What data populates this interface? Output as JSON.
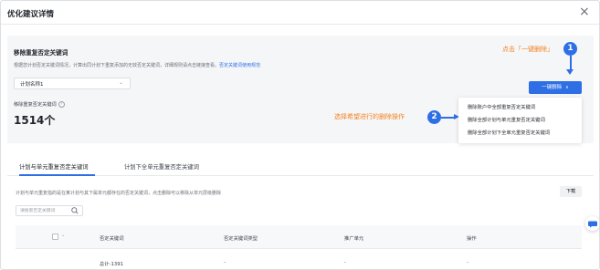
{
  "dialog": {
    "title": "优化建议详情",
    "close_symbol": "×"
  },
  "section": {
    "title": "移除重复否定关键词",
    "desc_text": "根据您计划否定关键词情况，计算出同计划下重复添加的无效否定关键词，详细规则请点击链接查看。",
    "desc_link": "否定关键词使用规范",
    "plan_select_value": "计划名称1",
    "repeat_label": "移除重复否定关键词",
    "repeat_help": "?",
    "repeat_count": "1514个"
  },
  "annotations": {
    "step1_text": "点击「一键删除」",
    "step1_num": "1",
    "step2_text": "选择希望进行的删除操作",
    "step2_num": "2"
  },
  "actions": {
    "delete_button": "一键删除",
    "dropdown_items": [
      "删除账户中全部重复否定关键词",
      "删除全部计划与单元重复否定关键词",
      "删除全部计划下全单元重复否定关键词"
    ]
  },
  "tabs": [
    {
      "label": "计划与单元重复否定关键词",
      "active": true
    },
    {
      "label": "计划下全单元重复否定关键词",
      "active": false
    }
  ],
  "tab_desc": "计划与单元重复指的是在某计划与其下属单元都存在的否定关键词，点击删除可以移除从单元层级删除",
  "download_label": "下载",
  "search": {
    "placeholder": "请搜索否定关键词"
  },
  "table": {
    "columns": [
      "否定关键词",
      "否定关键词类型",
      "推广单元",
      "操作"
    ],
    "rows": [
      {
        "keyword": "总计-1391",
        "type": "-",
        "unit": "-",
        "action": "-"
      }
    ]
  },
  "colors": {
    "accent": "#2e6fe6",
    "annotation": "#f5821f"
  }
}
